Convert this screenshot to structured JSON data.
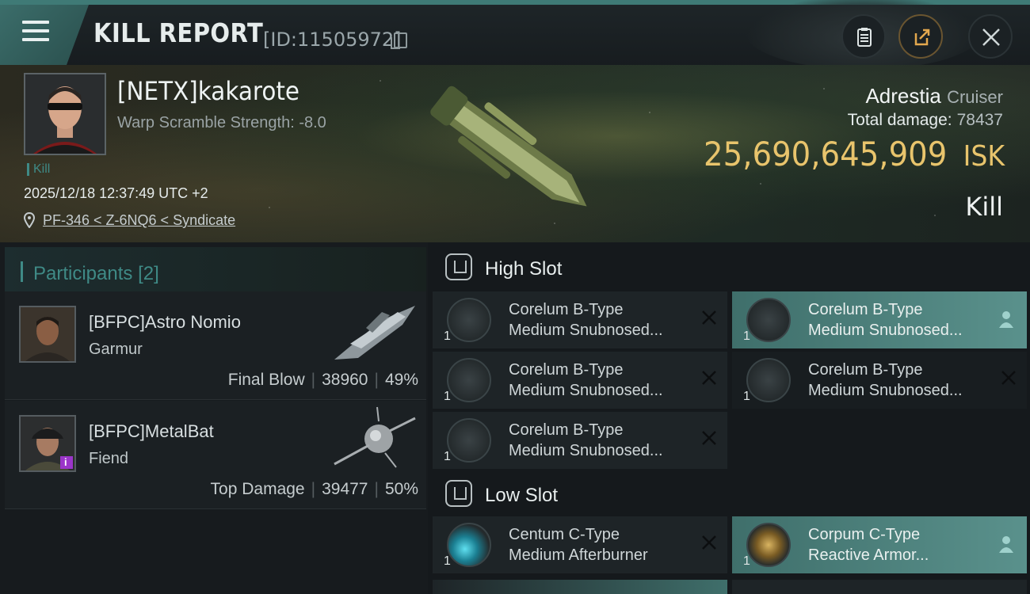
{
  "header": {
    "title": "KILL REPORT",
    "id_text": "[ID:11505972]"
  },
  "victim": {
    "name": "[NETX]kakarote",
    "warp_scramble": "Warp Scramble Strength: -8.0",
    "kill_tag": "Kill",
    "datetime": "2025/12/18 12:37:49 UTC +2",
    "location": "PF-346 < Z-6NQ6 < Syndicate",
    "ship_name": "Adrestia",
    "ship_class": "Cruiser",
    "total_damage_label": "Total damage:",
    "total_damage": "78437",
    "isk_value": "25,690,645,909",
    "isk_currency": "ISK",
    "result_label": "Kill"
  },
  "participants": {
    "header": "Participants",
    "count": "[2]",
    "list": [
      {
        "name": "[BFPC]Astro Nomio",
        "ship": "Garmur",
        "role": "Final Blow",
        "damage": "38960",
        "percent": "49%"
      },
      {
        "name": "[BFPC]MetalBat",
        "ship": "Fiend",
        "role": "Top Damage",
        "damage": "39477",
        "percent": "50%"
      }
    ]
  },
  "slots": {
    "high": {
      "title": "High Slot",
      "modules": [
        {
          "line1": "Corelum B-Type",
          "line2": "Medium Snubnosed...",
          "qty": "1",
          "state": "destroyed"
        },
        {
          "line1": "Corelum B-Type",
          "line2": "Medium Snubnosed...",
          "qty": "1",
          "state": "dropped"
        },
        {
          "line1": "Corelum B-Type",
          "line2": "Medium Snubnosed...",
          "qty": "1",
          "state": "destroyed"
        },
        {
          "line1": "Corelum B-Type",
          "line2": "Medium Snubnosed...",
          "qty": "1",
          "state": "destroyed"
        },
        {
          "line1": "Corelum B-Type",
          "line2": "Medium Snubnosed...",
          "qty": "1",
          "state": "destroyed"
        }
      ]
    },
    "low": {
      "title": "Low Slot",
      "modules": [
        {
          "line1": "Centum C-Type",
          "line2": "Medium Afterburner",
          "qty": "1",
          "state": "destroyed"
        },
        {
          "line1": "Corpum C-Type",
          "line2": "Reactive Armor...",
          "qty": "1",
          "state": "dropped"
        }
      ]
    }
  },
  "colors": {
    "accent": "#3f8a86",
    "isk": "#e8c46c",
    "dropped_bg": "#5a918c"
  }
}
